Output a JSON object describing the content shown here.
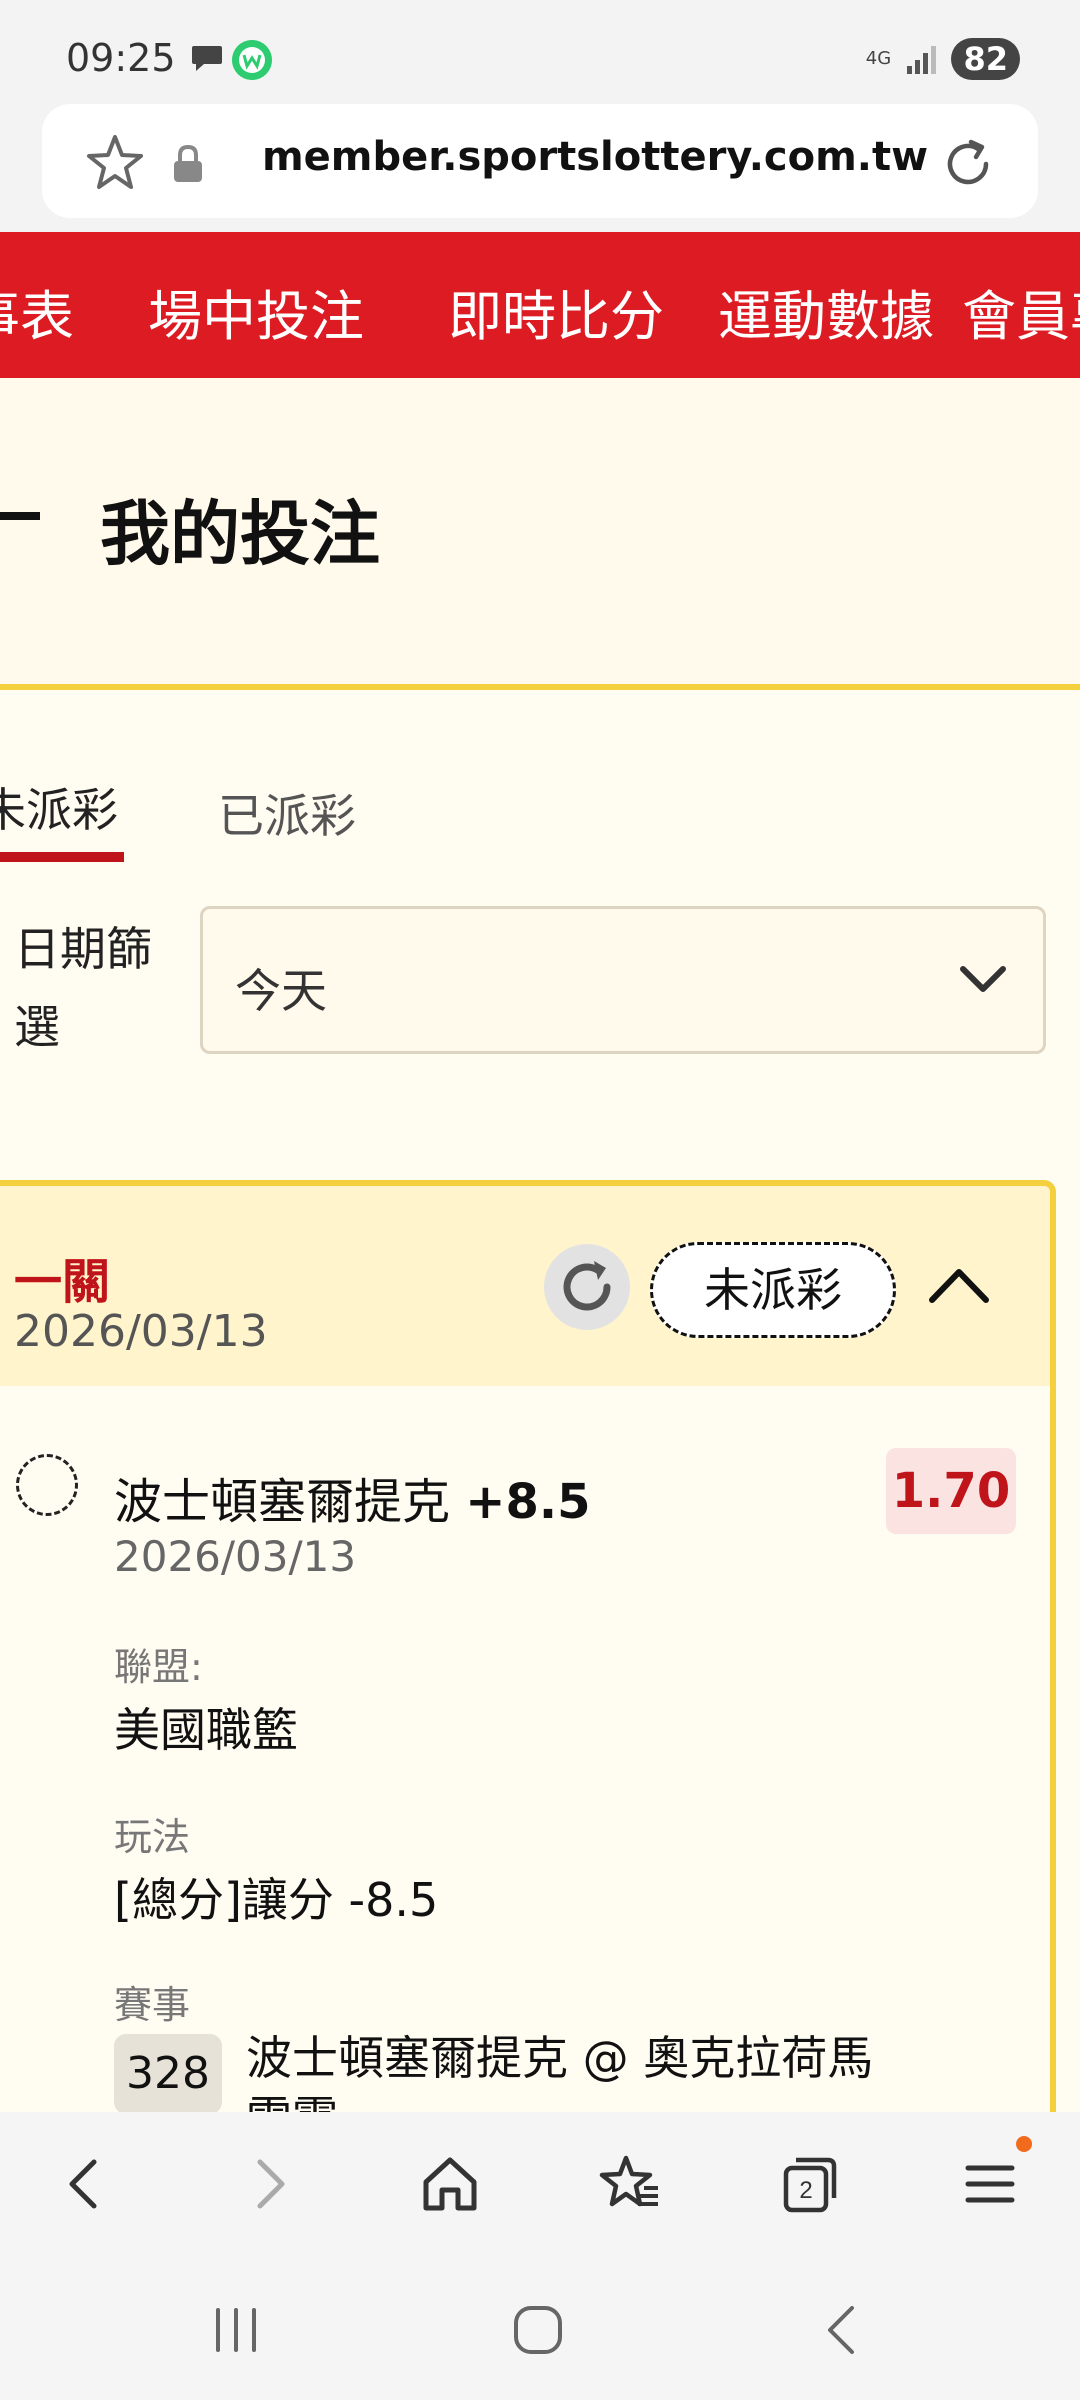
{
  "status_bar": {
    "time": "09:25",
    "network": "4G",
    "battery": "82"
  },
  "browser": {
    "url": "member.sportslottery.com.tw"
  },
  "nav": {
    "items": [
      "賽事表",
      "場中投注",
      "即時比分",
      "運動數據",
      "會員專區"
    ]
  },
  "page": {
    "title": "我的投注"
  },
  "tabs": {
    "unpaid": "未派彩",
    "paid": "已派彩"
  },
  "filter": {
    "label": "日期篩選",
    "value": "今天"
  },
  "bet": {
    "type": "一關",
    "date": "2026/03/13",
    "status": "未派彩",
    "selection_team": "波士頓塞爾提克",
    "selection_handicap": "+8.5",
    "match_date": "2026/03/13",
    "odds": "1.70",
    "league_label": "聯盟:",
    "league": "美國職籃",
    "market_label": "玩法",
    "market": "[總分]讓分 -8.5",
    "event_label": "賽事",
    "event_code": "328",
    "event_name": "波士頓塞爾提克 @ 奧克拉荷馬雷霆"
  },
  "colors": {
    "brand_red": "#dd1b22",
    "accent_yellow": "#f4d03f",
    "odds_red": "#c0141b"
  }
}
